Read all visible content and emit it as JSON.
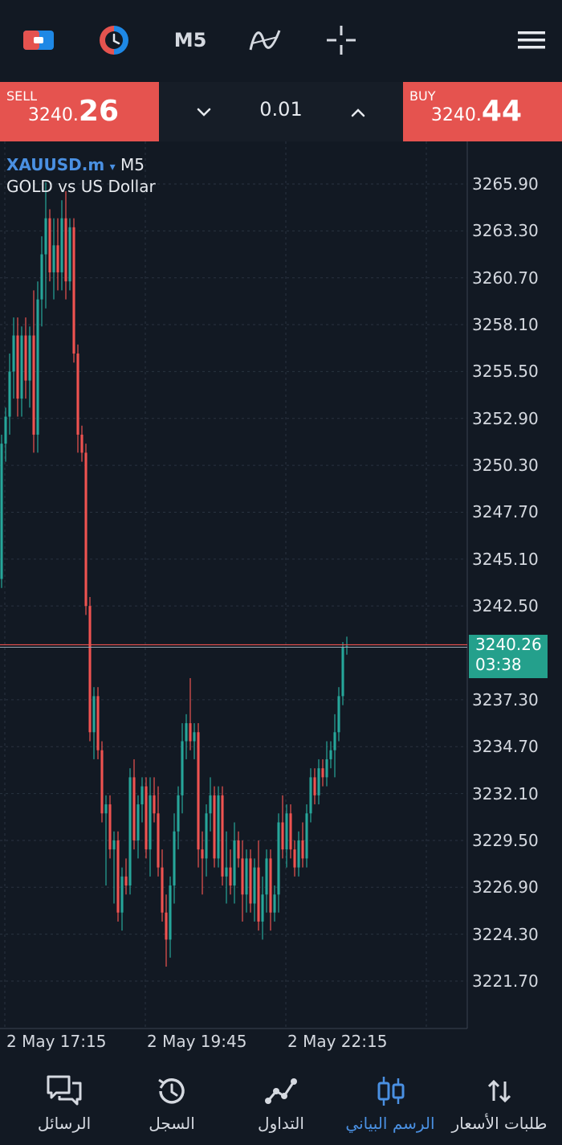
{
  "toolbar": {
    "timeframe": "M5"
  },
  "trade": {
    "sell_label": "SELL",
    "sell_price_small": "3240.",
    "sell_price_big": "26",
    "buy_label": "BUY",
    "buy_price_small": "3240.",
    "buy_price_big": "44",
    "lot": "0.01"
  },
  "chart": {
    "symbol": "XAUUSD.m",
    "symbol_caret": "▾",
    "timeframe": "M5",
    "description": "GOLD vs US Dollar",
    "price_labels": [
      "3265.90",
      "3263.30",
      "3260.70",
      "3258.10",
      "3255.50",
      "3252.90",
      "3250.30",
      "3247.70",
      "3245.10",
      "3242.50",
      "3237.30",
      "3234.70",
      "3232.10",
      "3229.50",
      "3226.90",
      "3224.30",
      "3221.70"
    ],
    "current_price": "3240.26",
    "countdown": "03:38",
    "time_labels": [
      "2 May 17:15",
      "2 May 19:45",
      "2 May 22:15"
    ]
  },
  "colors": {
    "up": "#26a69a",
    "down": "#ef5350",
    "accent": "#4a90e2",
    "background": "#121923"
  },
  "chart_data": {
    "type": "candlestick",
    "symbol": "XAUUSD.m",
    "timeframe": "M5",
    "ylim": [
      3220.5,
      3267.0
    ],
    "candles": [
      {
        "o": 3244.0,
        "h": 3252.0,
        "l": 3243.5,
        "c": 3251.5
      },
      {
        "o": 3251.5,
        "h": 3253.5,
        "l": 3250.5,
        "c": 3253.0
      },
      {
        "o": 3253.0,
        "h": 3256.5,
        "l": 3252.0,
        "c": 3255.5
      },
      {
        "o": 3255.5,
        "h": 3258.5,
        "l": 3254.0,
        "c": 3257.5
      },
      {
        "o": 3257.5,
        "h": 3258.5,
        "l": 3253.0,
        "c": 3254.0
      },
      {
        "o": 3254.0,
        "h": 3258.0,
        "l": 3253.0,
        "c": 3257.5
      },
      {
        "o": 3257.5,
        "h": 3258.5,
        "l": 3254.0,
        "c": 3255.0
      },
      {
        "o": 3255.0,
        "h": 3258.0,
        "l": 3253.5,
        "c": 3257.5
      },
      {
        "o": 3257.5,
        "h": 3260.0,
        "l": 3251.0,
        "c": 3252.0
      },
      {
        "o": 3252.0,
        "h": 3260.5,
        "l": 3251.0,
        "c": 3259.5
      },
      {
        "o": 3259.5,
        "h": 3263.0,
        "l": 3258.0,
        "c": 3262.0
      },
      {
        "o": 3262.0,
        "h": 3266.0,
        "l": 3259.0,
        "c": 3264.0
      },
      {
        "o": 3264.0,
        "h": 3264.5,
        "l": 3260.5,
        "c": 3261.0
      },
      {
        "o": 3261.0,
        "h": 3264.0,
        "l": 3259.5,
        "c": 3262.5
      },
      {
        "o": 3262.5,
        "h": 3264.0,
        "l": 3260.0,
        "c": 3261.0
      },
      {
        "o": 3261.0,
        "h": 3265.0,
        "l": 3260.0,
        "c": 3264.0
      },
      {
        "o": 3264.0,
        "h": 3265.5,
        "l": 3259.5,
        "c": 3260.5
      },
      {
        "o": 3260.5,
        "h": 3264.0,
        "l": 3260.0,
        "c": 3263.5
      },
      {
        "o": 3263.5,
        "h": 3264.0,
        "l": 3256.0,
        "c": 3256.5
      },
      {
        "o": 3256.5,
        "h": 3257.0,
        "l": 3251.0,
        "c": 3252.0
      },
      {
        "o": 3252.0,
        "h": 3252.5,
        "l": 3250.5,
        "c": 3251.0
      },
      {
        "o": 3251.0,
        "h": 3251.5,
        "l": 3242.0,
        "c": 3242.5
      },
      {
        "o": 3242.5,
        "h": 3243.0,
        "l": 3235.0,
        "c": 3235.5
      },
      {
        "o": 3235.5,
        "h": 3238.0,
        "l": 3234.0,
        "c": 3237.5
      },
      {
        "o": 3237.5,
        "h": 3238.0,
        "l": 3234.0,
        "c": 3234.5
      },
      {
        "o": 3234.5,
        "h": 3235.0,
        "l": 3230.5,
        "c": 3231.0
      },
      {
        "o": 3231.0,
        "h": 3232.0,
        "l": 3227.0,
        "c": 3231.5
      },
      {
        "o": 3231.5,
        "h": 3232.0,
        "l": 3228.5,
        "c": 3229.0
      },
      {
        "o": 3229.0,
        "h": 3230.0,
        "l": 3226.0,
        "c": 3229.5
      },
      {
        "o": 3229.5,
        "h": 3230.0,
        "l": 3225.0,
        "c": 3225.5
      },
      {
        "o": 3225.5,
        "h": 3228.0,
        "l": 3224.5,
        "c": 3227.5
      },
      {
        "o": 3227.5,
        "h": 3228.5,
        "l": 3226.5,
        "c": 3227.0
      },
      {
        "o": 3227.0,
        "h": 3233.5,
        "l": 3226.5,
        "c": 3233.0
      },
      {
        "o": 3233.0,
        "h": 3234.0,
        "l": 3229.0,
        "c": 3229.5
      },
      {
        "o": 3229.5,
        "h": 3232.0,
        "l": 3228.5,
        "c": 3231.5
      },
      {
        "o": 3231.5,
        "h": 3233.0,
        "l": 3230.5,
        "c": 3232.5
      },
      {
        "o": 3232.5,
        "h": 3233.0,
        "l": 3228.5,
        "c": 3229.0
      },
      {
        "o": 3229.0,
        "h": 3233.0,
        "l": 3227.5,
        "c": 3232.0
      },
      {
        "o": 3232.0,
        "h": 3233.0,
        "l": 3230.5,
        "c": 3231.0
      },
      {
        "o": 3231.0,
        "h": 3232.5,
        "l": 3227.5,
        "c": 3228.0
      },
      {
        "o": 3228.0,
        "h": 3229.0,
        "l": 3225.0,
        "c": 3225.5
      },
      {
        "o": 3225.5,
        "h": 3226.5,
        "l": 3222.5,
        "c": 3224.0
      },
      {
        "o": 3224.0,
        "h": 3227.5,
        "l": 3223.0,
        "c": 3227.0
      },
      {
        "o": 3227.0,
        "h": 3231.0,
        "l": 3226.0,
        "c": 3230.0
      },
      {
        "o": 3230.0,
        "h": 3232.5,
        "l": 3229.0,
        "c": 3232.0
      },
      {
        "o": 3232.0,
        "h": 3236.0,
        "l": 3231.0,
        "c": 3235.0
      },
      {
        "o": 3235.0,
        "h": 3236.5,
        "l": 3234.0,
        "c": 3236.0
      },
      {
        "o": 3236.0,
        "h": 3238.5,
        "l": 3234.5,
        "c": 3235.0
      },
      {
        "o": 3235.0,
        "h": 3236.0,
        "l": 3234.0,
        "c": 3235.5
      },
      {
        "o": 3235.5,
        "h": 3236.0,
        "l": 3228.0,
        "c": 3229.0
      },
      {
        "o": 3229.0,
        "h": 3230.0,
        "l": 3226.5,
        "c": 3228.5
      },
      {
        "o": 3228.5,
        "h": 3231.5,
        "l": 3227.5,
        "c": 3231.0
      },
      {
        "o": 3231.0,
        "h": 3233.0,
        "l": 3230.0,
        "c": 3232.0
      },
      {
        "o": 3232.0,
        "h": 3232.5,
        "l": 3228.0,
        "c": 3228.5
      },
      {
        "o": 3228.5,
        "h": 3232.5,
        "l": 3228.0,
        "c": 3232.0
      },
      {
        "o": 3232.0,
        "h": 3232.5,
        "l": 3227.0,
        "c": 3227.5
      },
      {
        "o": 3227.5,
        "h": 3230.0,
        "l": 3226.0,
        "c": 3228.0
      },
      {
        "o": 3228.0,
        "h": 3229.0,
        "l": 3226.5,
        "c": 3227.0
      },
      {
        "o": 3227.0,
        "h": 3230.5,
        "l": 3226.0,
        "c": 3229.5
      },
      {
        "o": 3229.5,
        "h": 3230.0,
        "l": 3228.0,
        "c": 3228.5
      },
      {
        "o": 3228.5,
        "h": 3229.5,
        "l": 3225.0,
        "c": 3226.5
      },
      {
        "o": 3226.5,
        "h": 3229.0,
        "l": 3225.5,
        "c": 3228.5
      },
      {
        "o": 3228.5,
        "h": 3229.0,
        "l": 3225.5,
        "c": 3226.0
      },
      {
        "o": 3226.0,
        "h": 3228.5,
        "l": 3225.0,
        "c": 3228.0
      },
      {
        "o": 3228.0,
        "h": 3229.5,
        "l": 3224.5,
        "c": 3225.0
      },
      {
        "o": 3225.0,
        "h": 3227.5,
        "l": 3224.0,
        "c": 3226.5
      },
      {
        "o": 3226.5,
        "h": 3229.0,
        "l": 3225.5,
        "c": 3228.5
      },
      {
        "o": 3228.5,
        "h": 3229.0,
        "l": 3224.5,
        "c": 3225.5
      },
      {
        "o": 3225.5,
        "h": 3227.0,
        "l": 3225.0,
        "c": 3226.5
      },
      {
        "o": 3226.5,
        "h": 3231.0,
        "l": 3225.5,
        "c": 3230.5
      },
      {
        "o": 3230.5,
        "h": 3232.0,
        "l": 3228.5,
        "c": 3229.0
      },
      {
        "o": 3229.0,
        "h": 3231.5,
        "l": 3228.0,
        "c": 3231.0
      },
      {
        "o": 3231.0,
        "h": 3231.5,
        "l": 3228.5,
        "c": 3229.0
      },
      {
        "o": 3229.0,
        "h": 3229.5,
        "l": 3227.5,
        "c": 3228.0
      },
      {
        "o": 3228.0,
        "h": 3230.0,
        "l": 3227.5,
        "c": 3229.5
      },
      {
        "o": 3229.5,
        "h": 3230.5,
        "l": 3228.0,
        "c": 3228.5
      },
      {
        "o": 3228.5,
        "h": 3231.5,
        "l": 3228.0,
        "c": 3231.0
      },
      {
        "o": 3231.0,
        "h": 3233.5,
        "l": 3230.5,
        "c": 3233.0
      },
      {
        "o": 3233.0,
        "h": 3233.5,
        "l": 3231.5,
        "c": 3232.0
      },
      {
        "o": 3232.0,
        "h": 3234.0,
        "l": 3231.5,
        "c": 3233.5
      },
      {
        "o": 3233.5,
        "h": 3234.0,
        "l": 3232.5,
        "c": 3233.0
      },
      {
        "o": 3233.0,
        "h": 3235.0,
        "l": 3232.5,
        "c": 3234.0
      },
      {
        "o": 3234.0,
        "h": 3235.0,
        "l": 3233.5,
        "c": 3234.5
      },
      {
        "o": 3234.5,
        "h": 3236.5,
        "l": 3233.0,
        "c": 3235.5
      },
      {
        "o": 3235.5,
        "h": 3238.0,
        "l": 3235.0,
        "c": 3237.5
      },
      {
        "o": 3237.5,
        "h": 3240.5,
        "l": 3237.0,
        "c": 3240.2
      },
      {
        "o": 3240.2,
        "h": 3240.8,
        "l": 3239.8,
        "c": 3240.26
      }
    ]
  },
  "bottom_nav": {
    "quotes": "طلبات الأسعار",
    "chart": "الرسم البياني",
    "trade": "التداول",
    "history": "السجل",
    "messages": "الرسائل"
  }
}
